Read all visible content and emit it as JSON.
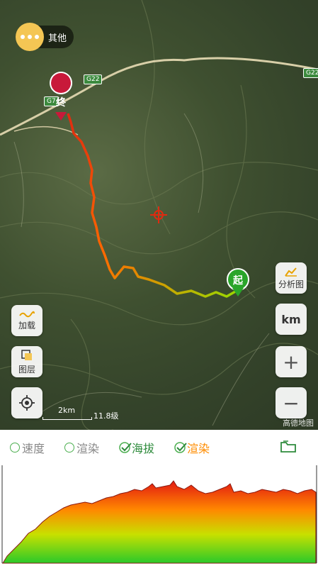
{
  "map": {
    "more_button_label": "其他",
    "road_labels": [
      "G22",
      "G22",
      "G7"
    ],
    "start_marker": "起",
    "end_marker": "终",
    "scale_text": "2km",
    "zoom_level_text": "11.8级",
    "watermark": "高德地图"
  },
  "controls": {
    "analysis_label": "分析图",
    "km_label": "km",
    "zoom_in": "+",
    "zoom_out": "−",
    "load_label": "加载",
    "layer_label": "图层"
  },
  "tabs": [
    {
      "label": "速度",
      "checked": false
    },
    {
      "label": "渲染",
      "checked": false
    },
    {
      "label": "海拔",
      "checked": true
    },
    {
      "label": "渲染",
      "checked": true
    }
  ],
  "colors": {
    "route_high": "#e02a10",
    "route_mid": "#ff8c00",
    "route_low": "#9ad800",
    "start_green": "#2aa52a",
    "end_red": "#c8193a",
    "accent_green": "#2e8b3c"
  }
}
